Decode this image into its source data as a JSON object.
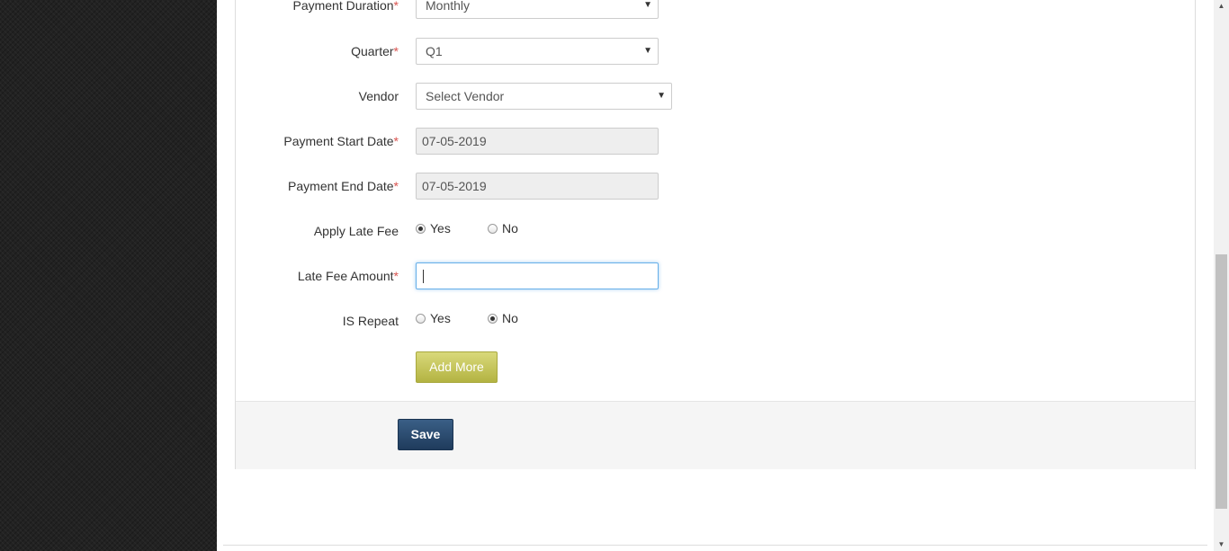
{
  "form": {
    "payment_duration": {
      "label": "Payment Duration",
      "required_mark": "*",
      "value": "Monthly"
    },
    "quarter": {
      "label": "Quarter",
      "required_mark": "*",
      "value": "Q1"
    },
    "vendor": {
      "label": "Vendor",
      "value": "Select Vendor"
    },
    "payment_start_date": {
      "label": "Payment Start Date",
      "required_mark": "*",
      "value": "07-05-2019"
    },
    "payment_end_date": {
      "label": "Payment End Date",
      "required_mark": "*",
      "value": "07-05-2019"
    },
    "apply_late_fee": {
      "label": "Apply Late Fee",
      "options": [
        "Yes",
        "No"
      ],
      "selected": "Yes"
    },
    "late_fee_amount": {
      "label": "Late Fee Amount",
      "required_mark": "*",
      "value": ""
    },
    "is_repeat": {
      "label": "IS Repeat",
      "options": [
        "Yes",
        "No"
      ],
      "selected": "No"
    },
    "add_more_label": "Add More",
    "save_label": "Save"
  },
  "icons": {
    "dropdown_arrow": "▼",
    "scroll_up": "▲",
    "scroll_down": "▼"
  },
  "colors": {
    "required": "#d9534f",
    "add_more_button": "#c4c45a",
    "save_button": "#2c4a6e",
    "focus_border": "#66afe9"
  }
}
